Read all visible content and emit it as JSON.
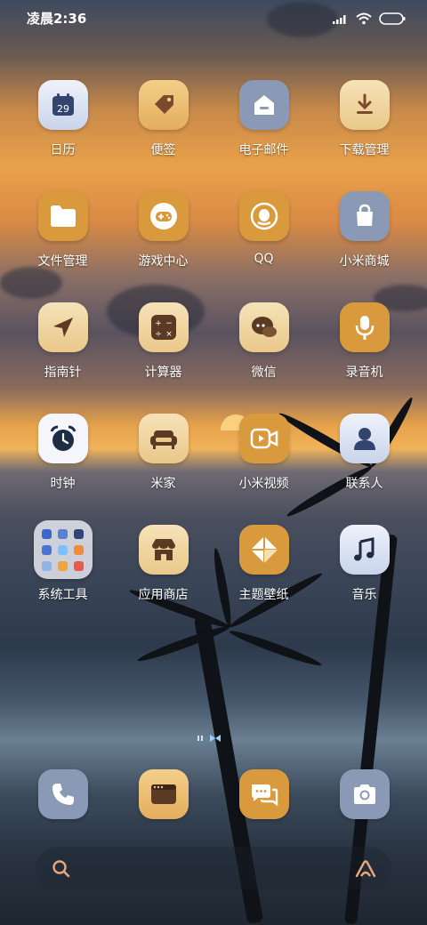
{
  "status_bar": {
    "time": "凌晨2:36"
  },
  "apps": [
    [
      {
        "name": "日历",
        "icon": "calendar-icon",
        "badge": "29"
      },
      {
        "name": "便签",
        "icon": "tag-icon"
      },
      {
        "name": "电子邮件",
        "icon": "mail-icon"
      },
      {
        "name": "下载管理",
        "icon": "download-icon"
      }
    ],
    [
      {
        "name": "文件管理",
        "icon": "folder-icon"
      },
      {
        "name": "游戏中心",
        "icon": "gamepad-icon"
      },
      {
        "name": "QQ",
        "icon": "penguin-icon"
      },
      {
        "name": "小米商城",
        "icon": "shopping-bag-icon"
      }
    ],
    [
      {
        "name": "指南针",
        "icon": "compass-arrow-icon"
      },
      {
        "name": "计算器",
        "icon": "calculator-icon"
      },
      {
        "name": "微信",
        "icon": "chat-bubble-icon"
      },
      {
        "name": "录音机",
        "icon": "microphone-icon"
      }
    ],
    [
      {
        "name": "时钟",
        "icon": "alarm-clock-icon"
      },
      {
        "name": "米家",
        "icon": "sofa-icon"
      },
      {
        "name": "小米视频",
        "icon": "video-play-icon"
      },
      {
        "name": "联系人",
        "icon": "person-icon"
      }
    ],
    [
      {
        "name": "系统工具",
        "icon": "folder-grid-icon"
      },
      {
        "name": "应用商店",
        "icon": "store-icon"
      },
      {
        "name": "主题壁纸",
        "icon": "theme-diamond-icon"
      },
      {
        "name": "音乐",
        "icon": "music-note-icon"
      }
    ]
  ],
  "dock": [
    {
      "icon": "phone-icon"
    },
    {
      "icon": "browser-window-icon"
    },
    {
      "icon": "messages-icon"
    },
    {
      "icon": "camera-icon"
    }
  ],
  "search_bar": {
    "left_icon": "search-icon",
    "right_icon": "assistant-icon"
  }
}
